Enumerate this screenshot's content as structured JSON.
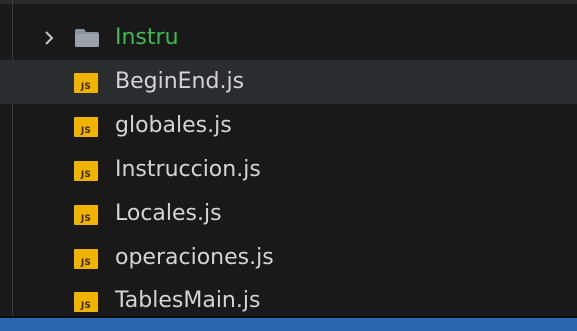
{
  "tree": {
    "folder": {
      "label": "Instru",
      "label_color": "#3fb950",
      "chevron_icon": "chevron-right-icon",
      "folder_icon": "folder-icon"
    },
    "files": [
      {
        "label": "BeginEnd.js",
        "icon": "js-file-icon",
        "badge": "JS",
        "hovered": true
      },
      {
        "label": "globales.js",
        "icon": "js-file-icon",
        "badge": "JS"
      },
      {
        "label": "Instruccion.js",
        "icon": "js-file-icon",
        "badge": "JS"
      },
      {
        "label": "Locales.js",
        "icon": "js-file-icon",
        "badge": "JS"
      },
      {
        "label": "operaciones.js",
        "icon": "js-file-icon",
        "badge": "JS"
      },
      {
        "label": "TablesMain.js",
        "icon": "js-file-icon",
        "badge": "JS"
      }
    ]
  },
  "colors": {
    "background": "#191919",
    "hover_row": "#2a2d2e",
    "js_badge": "#f0b400",
    "status_bar": "#2a66b0"
  }
}
